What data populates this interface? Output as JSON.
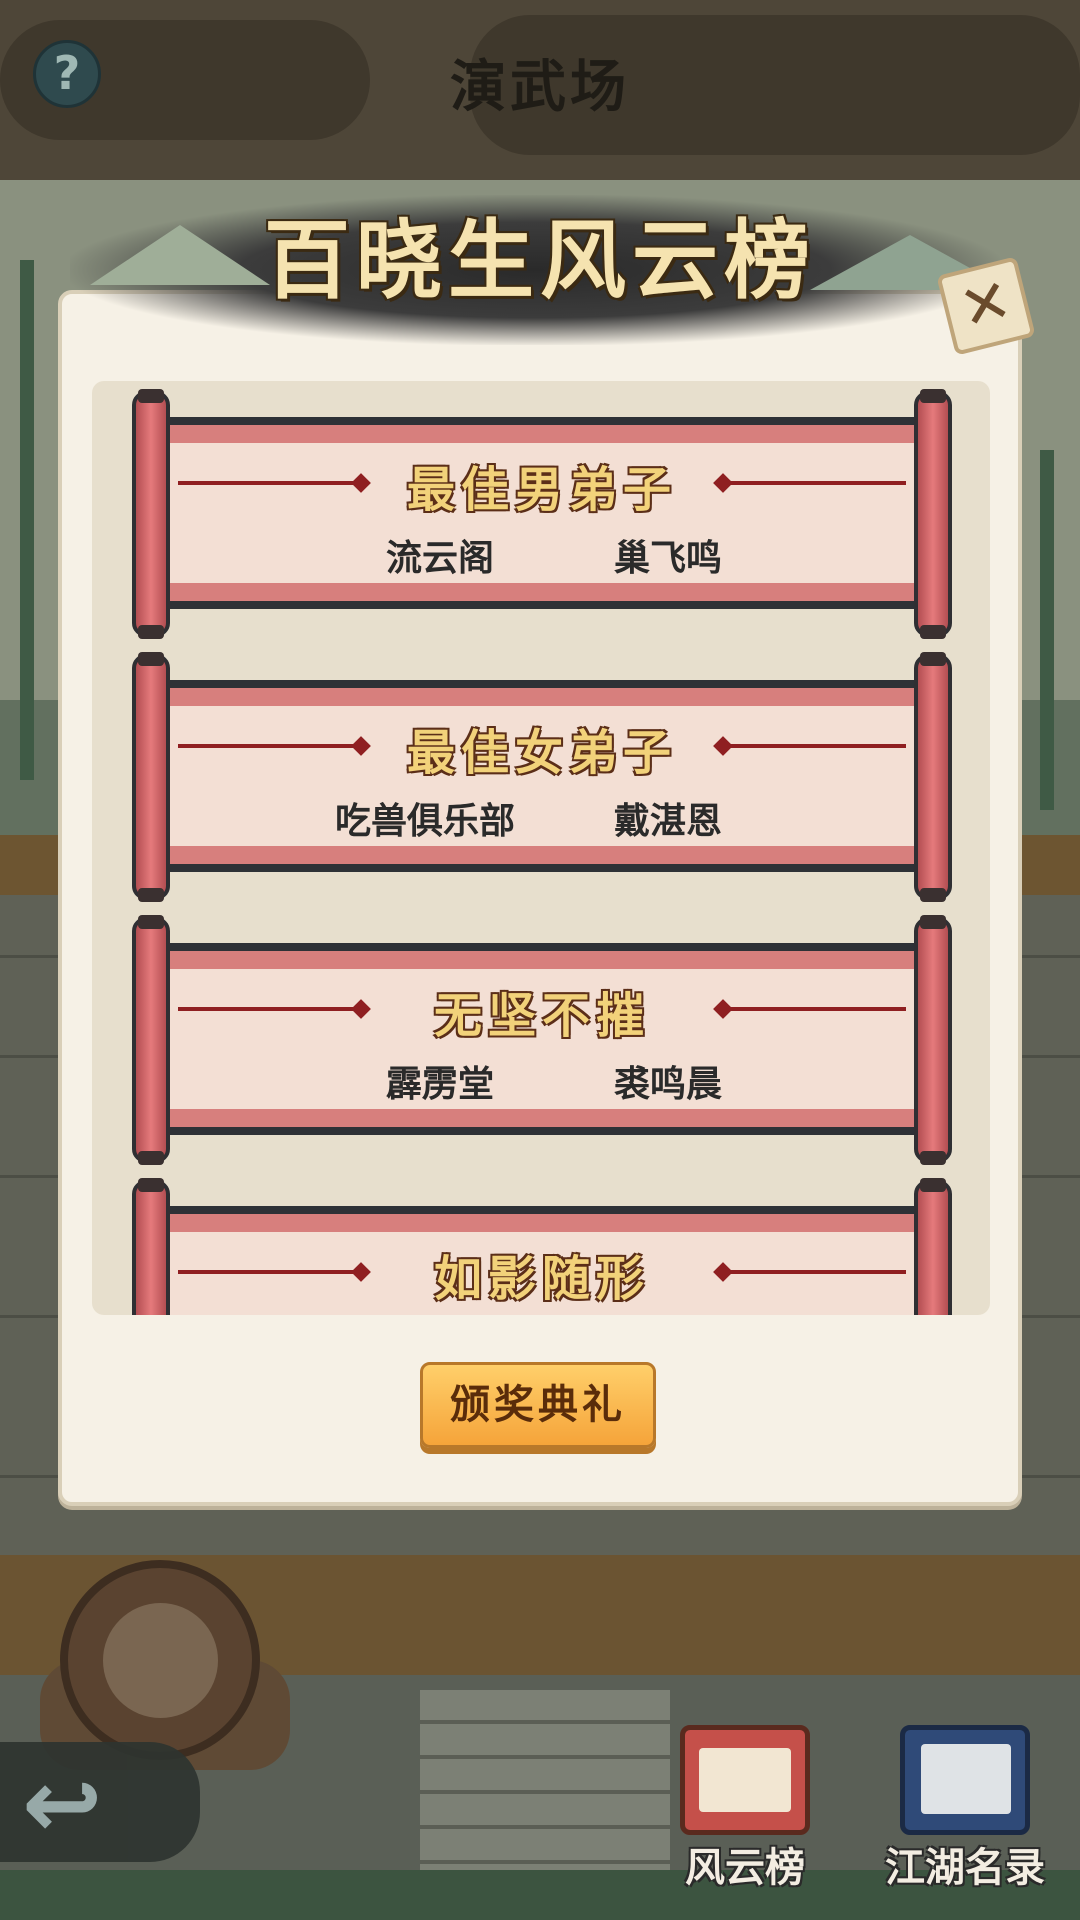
{
  "header": {
    "title": "演武场",
    "help_symbol": "?"
  },
  "panel": {
    "banner_title": "百晓生风云榜",
    "close_symbol": "✕",
    "awards": [
      {
        "title": "最佳男弟子",
        "winner_left": "流云阁",
        "winner_right": "巢飞鸣"
      },
      {
        "title": "最佳女弟子",
        "winner_left": "吃兽俱乐部",
        "winner_right": "戴湛恩"
      },
      {
        "title": "无坚不摧",
        "winner_left": "霹雳堂",
        "winner_right": "裘鸣晨"
      },
      {
        "title": "如影随形",
        "winner_left": "",
        "winner_right": ""
      }
    ],
    "ceremony_button": "颁奖典礼"
  },
  "nav": {
    "back_symbol": "↩",
    "items": [
      {
        "label": "风云榜",
        "icon": "scroll-icon"
      },
      {
        "label": "江湖名录",
        "icon": "book-icon"
      }
    ]
  },
  "colors": {
    "accent": "#f5a43a",
    "scroll_red": "#d77f7d",
    "title_gold": "#f2d27a"
  }
}
